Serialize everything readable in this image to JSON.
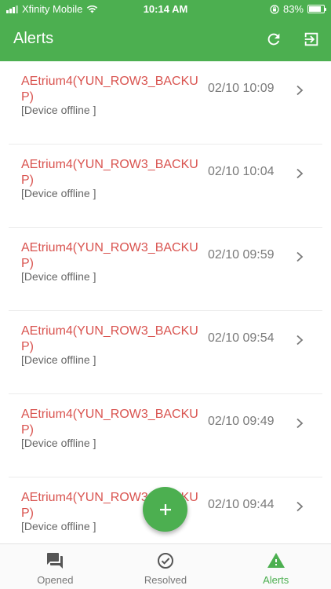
{
  "status_bar": {
    "carrier": "Xfinity Mobile",
    "time": "10:14 AM",
    "battery": "83%",
    "battery_level": 0.83
  },
  "header": {
    "title": "Alerts",
    "refresh_icon": "refresh-icon",
    "logout_icon": "logout-icon"
  },
  "alerts": [
    {
      "name": "AEtrium4(YUN_ROW3_BACKUP)",
      "desc": "[Device offline ]",
      "time": "02/10 10:09"
    },
    {
      "name": "AEtrium4(YUN_ROW3_BACKUP)",
      "desc": "[Device offline ]",
      "time": "02/10 10:04"
    },
    {
      "name": "AEtrium4(YUN_ROW3_BACKUP)",
      "desc": "[Device offline ]",
      "time": "02/10 09:59"
    },
    {
      "name": "AEtrium4(YUN_ROW3_BACKUP)",
      "desc": "[Device offline ]",
      "time": "02/10 09:54"
    },
    {
      "name": "AEtrium4(YUN_ROW3_BACKUP)",
      "desc": "[Device offline ]",
      "time": "02/10 09:49"
    },
    {
      "name": "AEtrium4(YUN_ROW3_BACKUP)",
      "desc": "[Device offline ]",
      "time": "02/10 09:44"
    }
  ],
  "fab": {
    "icon": "plus-icon"
  },
  "tabs": [
    {
      "label": "Opened",
      "icon": "chat-icon",
      "active": false
    },
    {
      "label": "Resolved",
      "icon": "check-circle-icon",
      "active": false
    },
    {
      "label": "Alerts",
      "icon": "warning-icon",
      "active": true
    }
  ],
  "colors": {
    "primary": "#4CAF50",
    "alert_text": "#d9534f"
  }
}
